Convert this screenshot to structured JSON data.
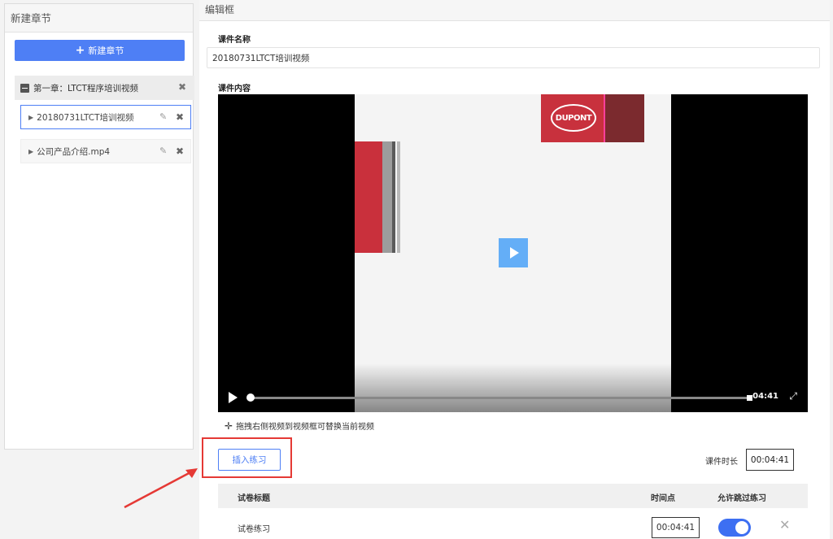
{
  "left_panel": {
    "title": "新建章节",
    "new_chapter_label": "新建章节",
    "chapter": {
      "label": "第一章：LTCT程序培训视频"
    },
    "lessons": [
      {
        "label": "20180731LTCT培训视频",
        "active": true
      },
      {
        "label": "公司产品介绍.mp4",
        "active": false
      }
    ]
  },
  "editor": {
    "title": "编辑框",
    "course_name_label": "课件名称",
    "course_name_value": "20180731LTCT培训视频",
    "course_content_label": "课件内容",
    "video": {
      "logo_text": "DUPONT",
      "current_time": "04:41"
    },
    "drag_hint": "拖拽右侧视频到视频框可替换当前视频",
    "insert_button": "插入练习",
    "duration_label": "课件时长",
    "duration_value": "00:04:41",
    "table": {
      "headers": [
        "试卷标题",
        "时间点",
        "允许跳过练习"
      ],
      "rows": [
        {
          "title": "试卷练习",
          "time": "00:04:41",
          "allow_skip": true
        }
      ]
    }
  },
  "colors": {
    "primary": "#4e7ff5",
    "highlight": "#e53935",
    "play_button": "#64aef7"
  }
}
